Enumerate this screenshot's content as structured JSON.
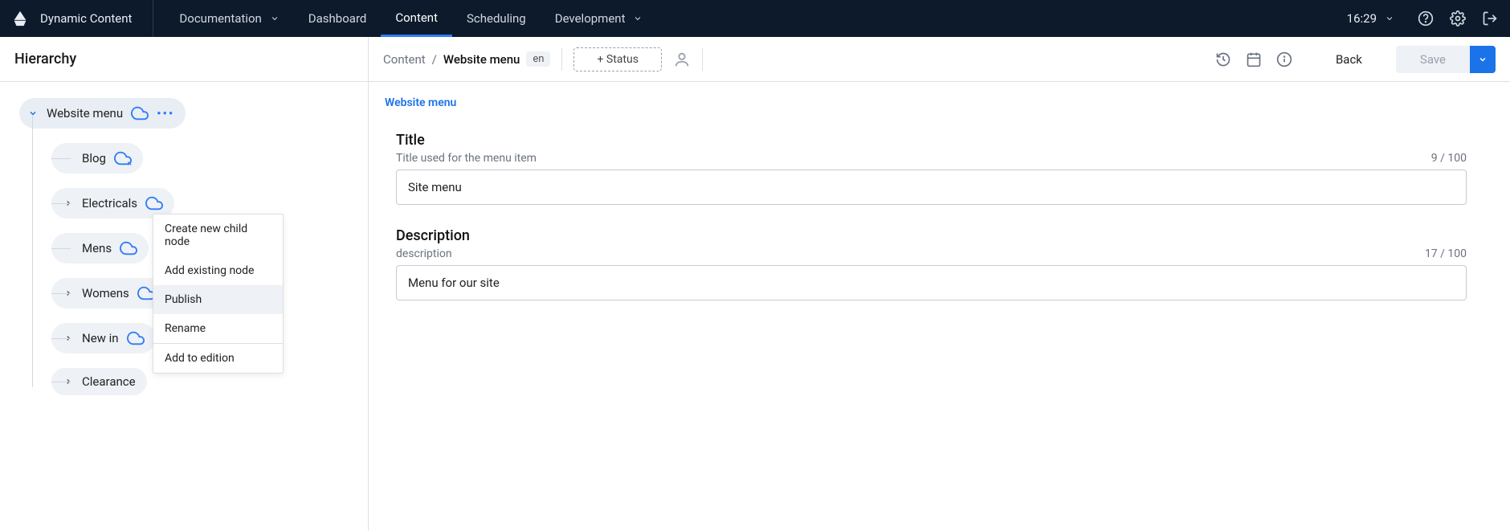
{
  "app_name": "Dynamic Content",
  "nav": {
    "documentation": "Documentation",
    "dashboard": "Dashboard",
    "content": "Content",
    "scheduling": "Scheduling",
    "development": "Development"
  },
  "time": "16:29",
  "sidebar": {
    "title": "Hierarchy",
    "root": "Website menu",
    "nodes": [
      "Blog",
      "Electricals",
      "Mens",
      "Womens",
      "New in",
      "Clearance"
    ]
  },
  "context_menu": {
    "create": "Create new child node",
    "add_existing": "Add existing node",
    "publish": "Publish",
    "rename": "Rename",
    "add_edition": "Add to edition"
  },
  "breadcrumb": {
    "root": "Content",
    "current": "Website menu",
    "lang": "en"
  },
  "toolbar": {
    "status": "+ Status",
    "back": "Back",
    "save": "Save"
  },
  "tab": "Website menu",
  "form": {
    "title_label": "Title",
    "title_help": "Title used for the menu item",
    "title_count": "9 / 100",
    "title_value": "Site menu",
    "desc_label": "Description",
    "desc_help": "description",
    "desc_count": "17 / 100",
    "desc_value": "Menu for our site"
  }
}
